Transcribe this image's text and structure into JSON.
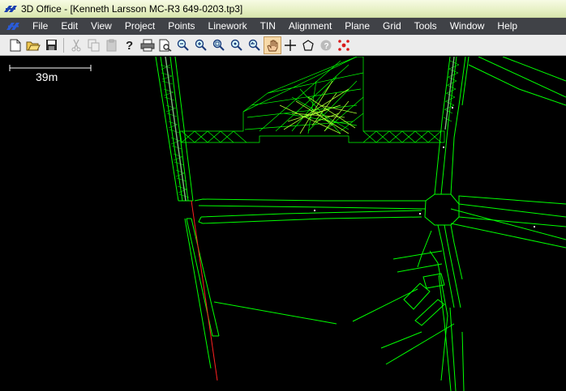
{
  "window": {
    "title": "3D Office - [Kenneth Larsson MC-R3 649-0203.tp3]",
    "accent_titlebar": "#e6f0c4"
  },
  "menubar": {
    "items": [
      "File",
      "Edit",
      "View",
      "Project",
      "Points",
      "Linework",
      "TIN",
      "Alignment",
      "Plane",
      "Grid",
      "Tools",
      "Window",
      "Help"
    ]
  },
  "toolbar": {
    "buttons": [
      {
        "icon": "new-document-icon",
        "enabled": true
      },
      {
        "icon": "open-folder-icon",
        "enabled": true
      },
      {
        "icon": "save-icon",
        "enabled": true
      },
      {
        "icon": "cut-icon",
        "enabled": false
      },
      {
        "icon": "copy-icon",
        "enabled": false
      },
      {
        "icon": "paste-icon",
        "enabled": false
      },
      {
        "icon": "help-icon",
        "enabled": true
      },
      {
        "icon": "print-icon",
        "enabled": true
      },
      {
        "icon": "print-preview-icon",
        "enabled": true
      },
      {
        "icon": "zoom-out-icon",
        "enabled": true
      },
      {
        "icon": "zoom-in-icon",
        "enabled": true
      },
      {
        "icon": "zoom-window-icon",
        "enabled": true
      },
      {
        "icon": "zoom-extents-icon",
        "enabled": true
      },
      {
        "icon": "zoom-previous-icon",
        "enabled": true
      },
      {
        "icon": "pan-hand-icon",
        "enabled": true,
        "active": true
      },
      {
        "icon": "crosshair-icon",
        "enabled": true
      },
      {
        "icon": "polygon-icon",
        "enabled": true
      },
      {
        "icon": "info-icon",
        "enabled": false
      },
      {
        "icon": "points-icon",
        "enabled": true
      }
    ]
  },
  "view": {
    "scale_bar_label": "39m",
    "background": "#000000",
    "linework_color": "#00ff00",
    "alignment_color": "#ff0000",
    "point_color": "#ffffff"
  }
}
